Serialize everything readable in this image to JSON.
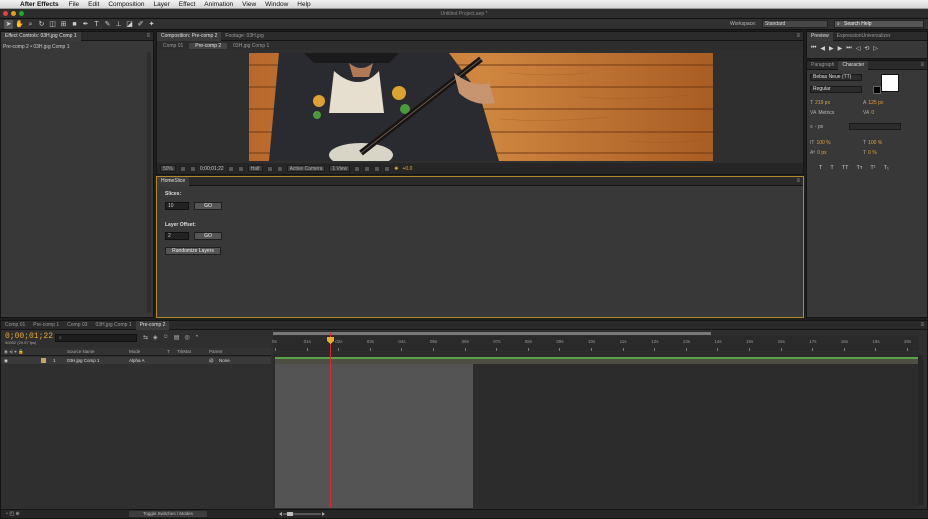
{
  "menubar": {
    "apple": "",
    "app_name": "After Effects",
    "items": [
      "File",
      "Edit",
      "Composition",
      "Layer",
      "Effect",
      "Animation",
      "View",
      "Window",
      "Help"
    ]
  },
  "window": {
    "title": "Untitled Project.aep *"
  },
  "toolbar": {
    "workspace_label": "Workspace:",
    "workspace_value": "Standard",
    "search_placeholder": "Search Help"
  },
  "effect_controls": {
    "tab": "Effect Controls: 03H.jpg Comp 1",
    "layer_path": "Pre-comp 2 • 03H.jpg Comp 1"
  },
  "composition": {
    "tabs": [
      "Composition: Pre-comp 2",
      "Footage: 03H.jpg"
    ],
    "subtabs": [
      "Comp 01",
      "Pre-comp 2",
      "03H.jpg Comp 1"
    ],
    "footer": {
      "zoom": "50%",
      "timecode": "0;00;01;22",
      "resolution": "Half",
      "camera": "Active Camera",
      "views": "1 View",
      "exposure": "+0.0"
    }
  },
  "homeslice": {
    "tab": "HomeSlice",
    "slices_label": "Slices:",
    "slices_value": "10",
    "go_label": "GO",
    "offset_label": "Layer Offset:",
    "offset_value": "2",
    "randomize_label": "Randomize Layers"
  },
  "preview": {
    "tabs": [
      "Preview",
      "ExpressionUniversalizer"
    ]
  },
  "character": {
    "tabs": [
      "Paragraph",
      "Character"
    ],
    "font": "Bebas Neue (TT)",
    "style": "Regular",
    "size": "219 px",
    "leading": "125 px",
    "kerning": "Metrics",
    "tracking": "0",
    "stroke": "- px",
    "vscale": "100 %",
    "hscale": "100 %",
    "baseline": "0 px",
    "tsume": "0 %",
    "fill_color": "#ffffff",
    "stroke_color": "#000000",
    "type_buttons": [
      "T",
      "T",
      "TT",
      "Tт",
      "T¹",
      "T₁"
    ]
  },
  "timeline": {
    "tabs": [
      "Comp 01",
      "Pre-comp 1",
      "Comp 03",
      "03H.jpg Comp 1",
      "Pre-comp 2"
    ],
    "timecode": "0;00;01;22",
    "timecode_sub": "00052 (29.97 fps)",
    "columns": [
      "Source Name",
      "Mode",
      "T",
      "TrkMat",
      "Parent"
    ],
    "layer": {
      "index": "1",
      "name": "03H.jpg Comp 1",
      "mode": "Alpha A",
      "parent": "None"
    },
    "ruler_ticks": [
      "0s",
      "01s",
      "02s",
      "03s",
      "04s",
      "05s",
      "06s",
      "07s",
      "08s",
      "09s",
      "10s",
      "11s",
      "12s",
      "13s",
      "14s",
      "15s",
      "16s",
      "17s",
      "18s",
      "19s",
      "20s"
    ],
    "toggle_label": "Toggle Switches / Modes"
  },
  "colors": {
    "accent_orange": "#e8a733",
    "playhead_red": "#d03030",
    "track_green": "#5aa44c",
    "panel_border_highlight": "#b08a2a"
  }
}
